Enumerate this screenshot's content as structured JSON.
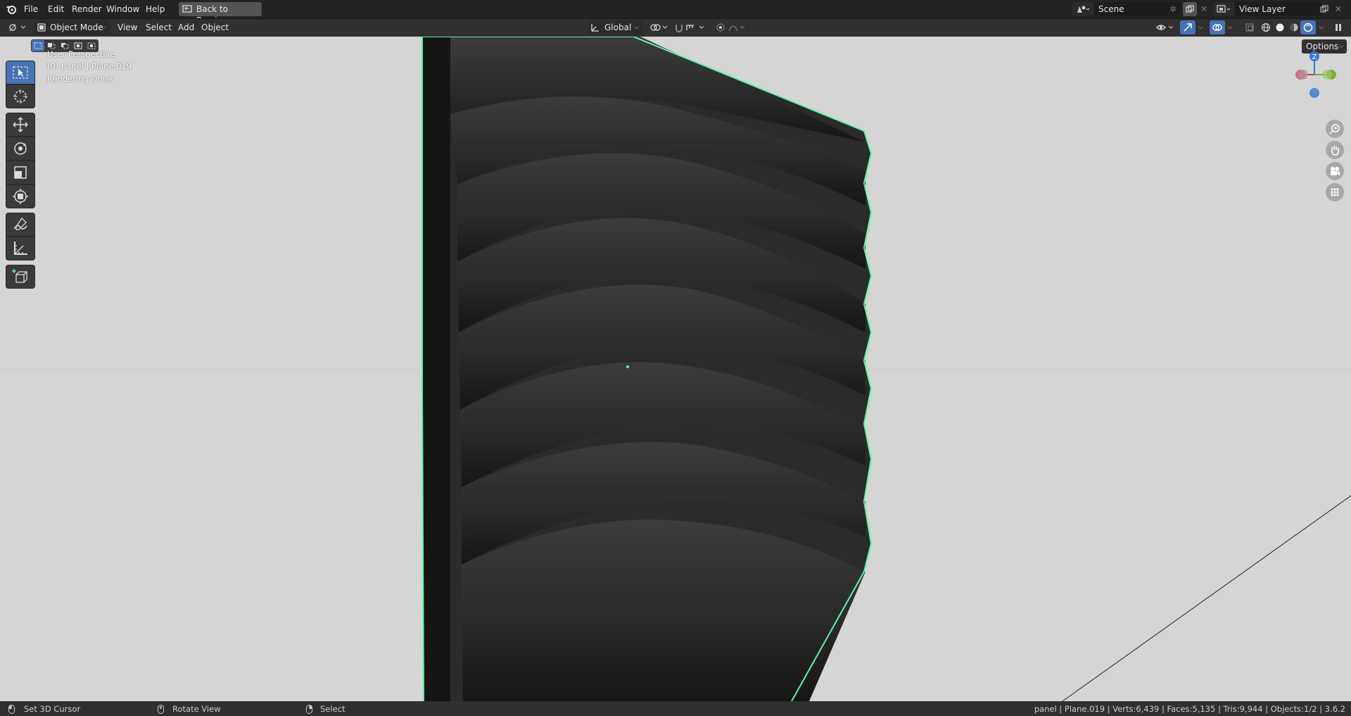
{
  "menus": [
    "File",
    "Edit",
    "Render",
    "Window",
    "Help"
  ],
  "back_button": "Back to Previous",
  "scene": {
    "name": "Scene"
  },
  "view_layer": {
    "name": "View Layer"
  },
  "header": {
    "mode": "Object Mode",
    "menus": [
      "View",
      "Select",
      "Add",
      "Object"
    ],
    "orientation": "Global"
  },
  "options_label": "Options",
  "overlay": {
    "perspective": "User Perspective",
    "object_info": "(0) panel | Plane.019",
    "render_status": "Rendering Done"
  },
  "gizmo": {
    "z_label": "Z"
  },
  "status": {
    "hint_left": "Set 3D Cursor",
    "hint_middle": "Rotate View",
    "hint_right": "Select",
    "stats": "panel | Plane.019 | Verts:6,439 | Faces:5,135 | Tris:9,944 | Objects:1/2 | 3.6.2"
  },
  "colors": {
    "active": "#4772b3",
    "selection_outline": "#5cf5a8",
    "viewport_bg": "#d5d5d5"
  },
  "icons": [
    "blender-logo",
    "back-icon",
    "scene-icon",
    "pin-icon",
    "copy-icon",
    "close-icon",
    "view-layer-icon",
    "editor-type-icon",
    "object-mode-icon",
    "orientation-icon",
    "pivot-icon",
    "snap-icon",
    "proportional-icon",
    "visibility-icon",
    "gizmo-icon",
    "overlay-icon",
    "xray-icon",
    "wireframe-shading-icon",
    "solid-shading-icon",
    "material-shading-icon",
    "rendered-shading-icon",
    "select-box-icon",
    "cursor-icon",
    "move-icon",
    "rotate-icon",
    "scale-icon",
    "transform-icon",
    "annotate-icon",
    "measure-icon",
    "add-cube-icon",
    "zoom-icon",
    "pan-icon",
    "camera-icon",
    "grid-icon",
    "mouse-icon"
  ]
}
